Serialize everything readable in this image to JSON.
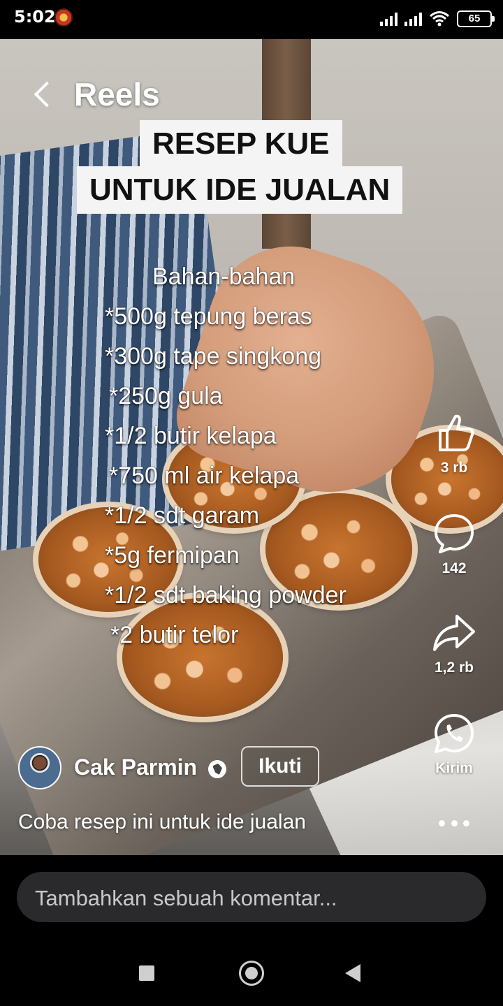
{
  "status_bar": {
    "time": "5:02",
    "battery": "65",
    "icons": [
      "app-notification-icon",
      "signal-icon",
      "signal-icon",
      "wifi-icon",
      "battery-icon"
    ]
  },
  "header": {
    "back_icon": "chevron-left-icon",
    "title": "Reels"
  },
  "video_overlay": {
    "caption_line1": "RESEP KUE",
    "caption_line2": "UNTUK IDE JUALAN",
    "recipe_header": "Bahan-bahan",
    "ingredients": [
      "*500g tepung beras",
      "*300g tape singkong",
      " *250g gula",
      "*1/2 butir kelapa",
      " *750 ml air kelapa",
      "*1/2 sdt garam",
      "*5g fermipan",
      "*1/2 sdt baking powder",
      " *2 butir telor"
    ]
  },
  "actions": {
    "like": {
      "icon": "thumbs-up-icon",
      "count": "3 rb"
    },
    "comment": {
      "icon": "comment-bubble-icon",
      "count": "142"
    },
    "share": {
      "icon": "share-arrow-icon",
      "count": "1,2 rb"
    },
    "send": {
      "icon": "whatsapp-icon",
      "label": "Kirim"
    }
  },
  "author": {
    "name": "Cak Parmin",
    "visibility_icon": "globe-icon",
    "follow_label": "Ikuti"
  },
  "description": "Coba resep ini untuk ide jualan",
  "more_icon": "more-horizontal-icon",
  "comment_box": {
    "placeholder": "Tambahkan sebuah komentar..."
  },
  "nav": {
    "recents_icon": "square-icon",
    "home_icon": "circle-home-icon",
    "back_icon": "triangle-back-icon"
  },
  "colors": {
    "background": "#000000",
    "caption_bg": "#f4f4f4",
    "comment_input_bg": "#2a2a2c"
  }
}
